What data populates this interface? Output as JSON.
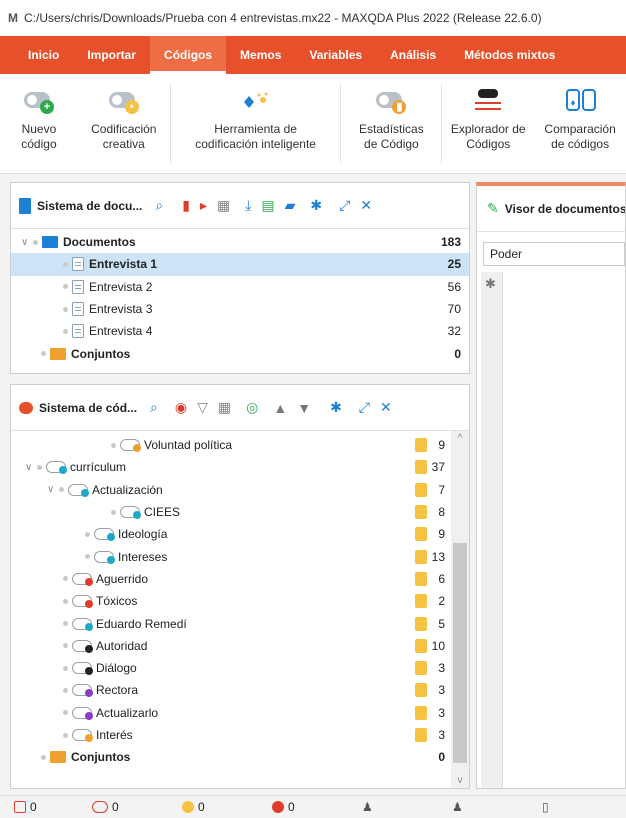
{
  "window": {
    "title": "C:/Users/chris/Downloads/Prueba con 4 entrevistas.mx22 - MAXQDA Plus 2022 (Release 22.6.0)",
    "logo": "M"
  },
  "tabs": [
    "Inicio",
    "Importar",
    "Códigos",
    "Memos",
    "Variables",
    "Análisis",
    "Métodos mixtos"
  ],
  "active_tab": "Códigos",
  "ribbon": {
    "new_code": "Nuevo\ncódigo",
    "creative": "Codificación\ncreativa",
    "smart": "Herramienta de\ncodificación inteligente",
    "stats": "Estadísticas\nde Código",
    "explorer": "Explorador de\nCódigos",
    "compare": "Comparación\nde códigos"
  },
  "doc_system": {
    "title": "Sistema de docu...",
    "rows": [
      {
        "label": "Documentos",
        "count": "183"
      },
      {
        "label": "Entrevista 1",
        "count": "25"
      },
      {
        "label": "Entrevista 2",
        "count": "56"
      },
      {
        "label": "Entrevista 3",
        "count": "70"
      },
      {
        "label": "Entrevista 4",
        "count": "32"
      },
      {
        "label": "Conjuntos",
        "count": "0"
      }
    ]
  },
  "code_system": {
    "title": "Sistema de cód...",
    "rows": [
      {
        "label": "Voluntad política",
        "count": "9",
        "color": "#f0a030"
      },
      {
        "label": "currículum",
        "count": "37",
        "color": "#1ea8c8"
      },
      {
        "label": "Actualización",
        "count": "7",
        "color": "#1ea8c8"
      },
      {
        "label": "CIEES",
        "count": "8",
        "color": "#1ea8c8"
      },
      {
        "label": "Ideología",
        "count": "9",
        "color": "#1ea8c8"
      },
      {
        "label": "Intereses",
        "count": "13",
        "color": "#1ea8c8"
      },
      {
        "label": "Aguerrido",
        "count": "6",
        "color": "#e03c2c"
      },
      {
        "label": "Tóxicos",
        "count": "2",
        "color": "#e03c2c"
      },
      {
        "label": "Eduardo Remedí",
        "count": "5",
        "color": "#1ea8c8"
      },
      {
        "label": "Autoridad",
        "count": "10",
        "color": "#222222"
      },
      {
        "label": "Diálogo",
        "count": "3",
        "color": "#222222"
      },
      {
        "label": "Rectora",
        "count": "3",
        "color": "#8a3cc8"
      },
      {
        "label": "Actualizarlo",
        "count": "3",
        "color": "#8a3cc8"
      },
      {
        "label": "Interés",
        "count": "3",
        "color": "#f0a030"
      },
      {
        "label": "Conjuntos",
        "count": "0",
        "color": "#f0a030"
      }
    ]
  },
  "viewer": {
    "title": "Visor de documentos",
    "dropdown": "Poder"
  },
  "status": [
    "0",
    "0",
    "0",
    "0"
  ],
  "colors": {
    "accent": "#e6512b",
    "selection": "#cde4f7"
  }
}
